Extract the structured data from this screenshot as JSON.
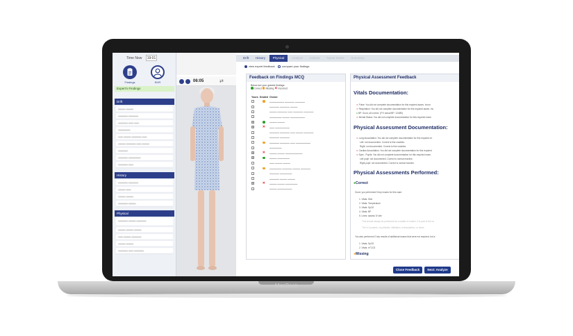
{
  "device": {
    "brand": "MacBook"
  },
  "sidebar": {
    "time_label": "Time Now",
    "time_value": "19:01",
    "findings_label": "Findings",
    "ehr_label": "EHR",
    "expert_label": "Expert's Findings",
    "groups": [
      "Drift",
      "History",
      "Physical"
    ]
  },
  "avatar": {
    "timer": "06:05"
  },
  "tabs": [
    "Drift",
    "History",
    "Physical",
    "Analyze",
    "Actions",
    "Nurse Notes",
    "Summary"
  ],
  "radios": {
    "view_expert": "view expert feedback",
    "compare": "compare your findings"
  },
  "mcq": {
    "title": "Feedback on Findings MCQ",
    "intro": "Below are your graded findings:",
    "legend": {
      "correct": "Correct",
      "missing": "Missing",
      "incorrect": "Incorrect"
    },
    "headers": [
      "Yours",
      "Graded",
      "Choice"
    ],
    "rows": [
      {
        "yours": false,
        "graded": "missing"
      },
      {
        "yours": false,
        "graded": ""
      },
      {
        "yours": false,
        "graded": ""
      },
      {
        "yours": false,
        "graded": ""
      },
      {
        "yours": true,
        "graded": "correct"
      },
      {
        "yours": true,
        "graded": "incorrect"
      },
      {
        "yours": false,
        "graded": ""
      },
      {
        "yours": false,
        "graded": ""
      },
      {
        "yours": false,
        "graded": "missing"
      },
      {
        "yours": false,
        "graded": ""
      },
      {
        "yours": true,
        "graded": "incorrect"
      },
      {
        "yours": true,
        "graded": "correct"
      },
      {
        "yours": false,
        "graded": ""
      },
      {
        "yours": false,
        "graded": "missing"
      },
      {
        "yours": false,
        "graded": ""
      },
      {
        "yours": false,
        "graded": ""
      },
      {
        "yours": true,
        "graded": "incorrect"
      },
      {
        "yours": false,
        "graded": ""
      }
    ]
  },
  "feedback": {
    "title": "Physical Assessment Feedback",
    "h1": "Vitals Documentation:",
    "vitals": [
      "Pulse: You did not complete documentation for this required asses. Incorr",
      "Respiration: You did not complete documentation for this required asses. Inc",
      "BP: Good, all correct. (FYI actual BP: 124/80)",
      "Mental Status: You did not complete documentation for this required exam"
    ],
    "h2": "Physical Assessment Documentation:",
    "pad": [
      "Lung Auscultation: You did not complete documentation for this required ex",
      "Left: not documented. Correct is fine crackles.",
      "Right: not documented. Correct is fine crackles.",
      "Cardiac Auscultation: You did not complete documentation for this required",
      "Eyes - Pupils: You did not complete documentation for this required exam.",
      "Left pupil: not documented. Correct is normal reactive.",
      "Right pupil: not documented. Correct is normal reactive."
    ],
    "h3": "Physical Assessments Performed:",
    "correct_label": "Correct",
    "good_line": "Good, you performed 5 key exams for this case:",
    "key_exams": [
      "1. Vitals: Skin",
      "2. Vitals: Temperature",
      "3. Vitals: SpO2",
      "4. Vitals: BP",
      "5. Lines: assess IV site"
    ],
    "note1": "This should always be performed as a matter of routine. It is part of the nu",
    "note2": "The IV is patent, no phlebitis, infiltration, extravasation, or heme",
    "also_line": "You also performed 2 key results of additional exams that were not required, but a",
    "extra_exams": [
      "1. Vitals: SpO2",
      "2. Vitals: eTCO2"
    ],
    "missing_label": "Missing"
  },
  "buttons": {
    "close": "Close Feedback",
    "next": "Next: Analyze"
  },
  "colors": {
    "brand": "#2d3f8a",
    "correct": "#2a9d2a",
    "missing": "#f0a020",
    "incorrect": "#dd2222"
  }
}
